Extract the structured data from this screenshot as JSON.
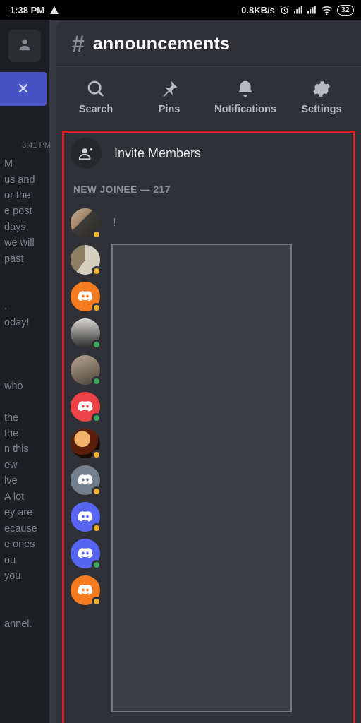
{
  "status": {
    "time": "1:38 PM",
    "net_rate": "0.8KB/s",
    "battery": "32"
  },
  "rail": {
    "close_glyph": "✕"
  },
  "under": {
    "time": "3:41 PM",
    "lines": [
      "M",
      "us and",
      "or the",
      "e post",
      "days,",
      "we will",
      "past",
      "",
      "",
      ".",
      "oday!",
      "",
      "",
      "",
      "who",
      "",
      "the",
      "the",
      "n this",
      "ew",
      "lve",
      "A lot",
      "ey are",
      "ecause",
      "e ones",
      "ou",
      "you",
      "",
      "",
      "annel."
    ]
  },
  "panel": {
    "hash": "#",
    "title": "announcements"
  },
  "tabs": {
    "search": "Search",
    "pins": "Pins",
    "notifications": "Notifications",
    "settings": "Settings"
  },
  "invite": {
    "label": "Invite Members"
  },
  "section": {
    "label": "NEW JOINEE — 217"
  },
  "members": [
    {
      "kind": "photo",
      "cls": "ph1",
      "status": "idle",
      "name": "!"
    },
    {
      "kind": "photo",
      "cls": "ph2",
      "status": "idle"
    },
    {
      "kind": "logo",
      "cls": "c-orange",
      "status": "idle"
    },
    {
      "kind": "photo",
      "cls": "ph3",
      "status": "online"
    },
    {
      "kind": "photo",
      "cls": "ph4",
      "status": "online"
    },
    {
      "kind": "logo",
      "cls": "c-red",
      "status": "online"
    },
    {
      "kind": "photo",
      "cls": "ph5",
      "status": "idle"
    },
    {
      "kind": "logo",
      "cls": "c-grey",
      "status": "idle"
    },
    {
      "kind": "logo",
      "cls": "c-blurp",
      "status": "idle"
    },
    {
      "kind": "logo",
      "cls": "c-blurp",
      "status": "online"
    },
    {
      "kind": "logo",
      "cls": "c-orange",
      "status": "idle"
    }
  ]
}
